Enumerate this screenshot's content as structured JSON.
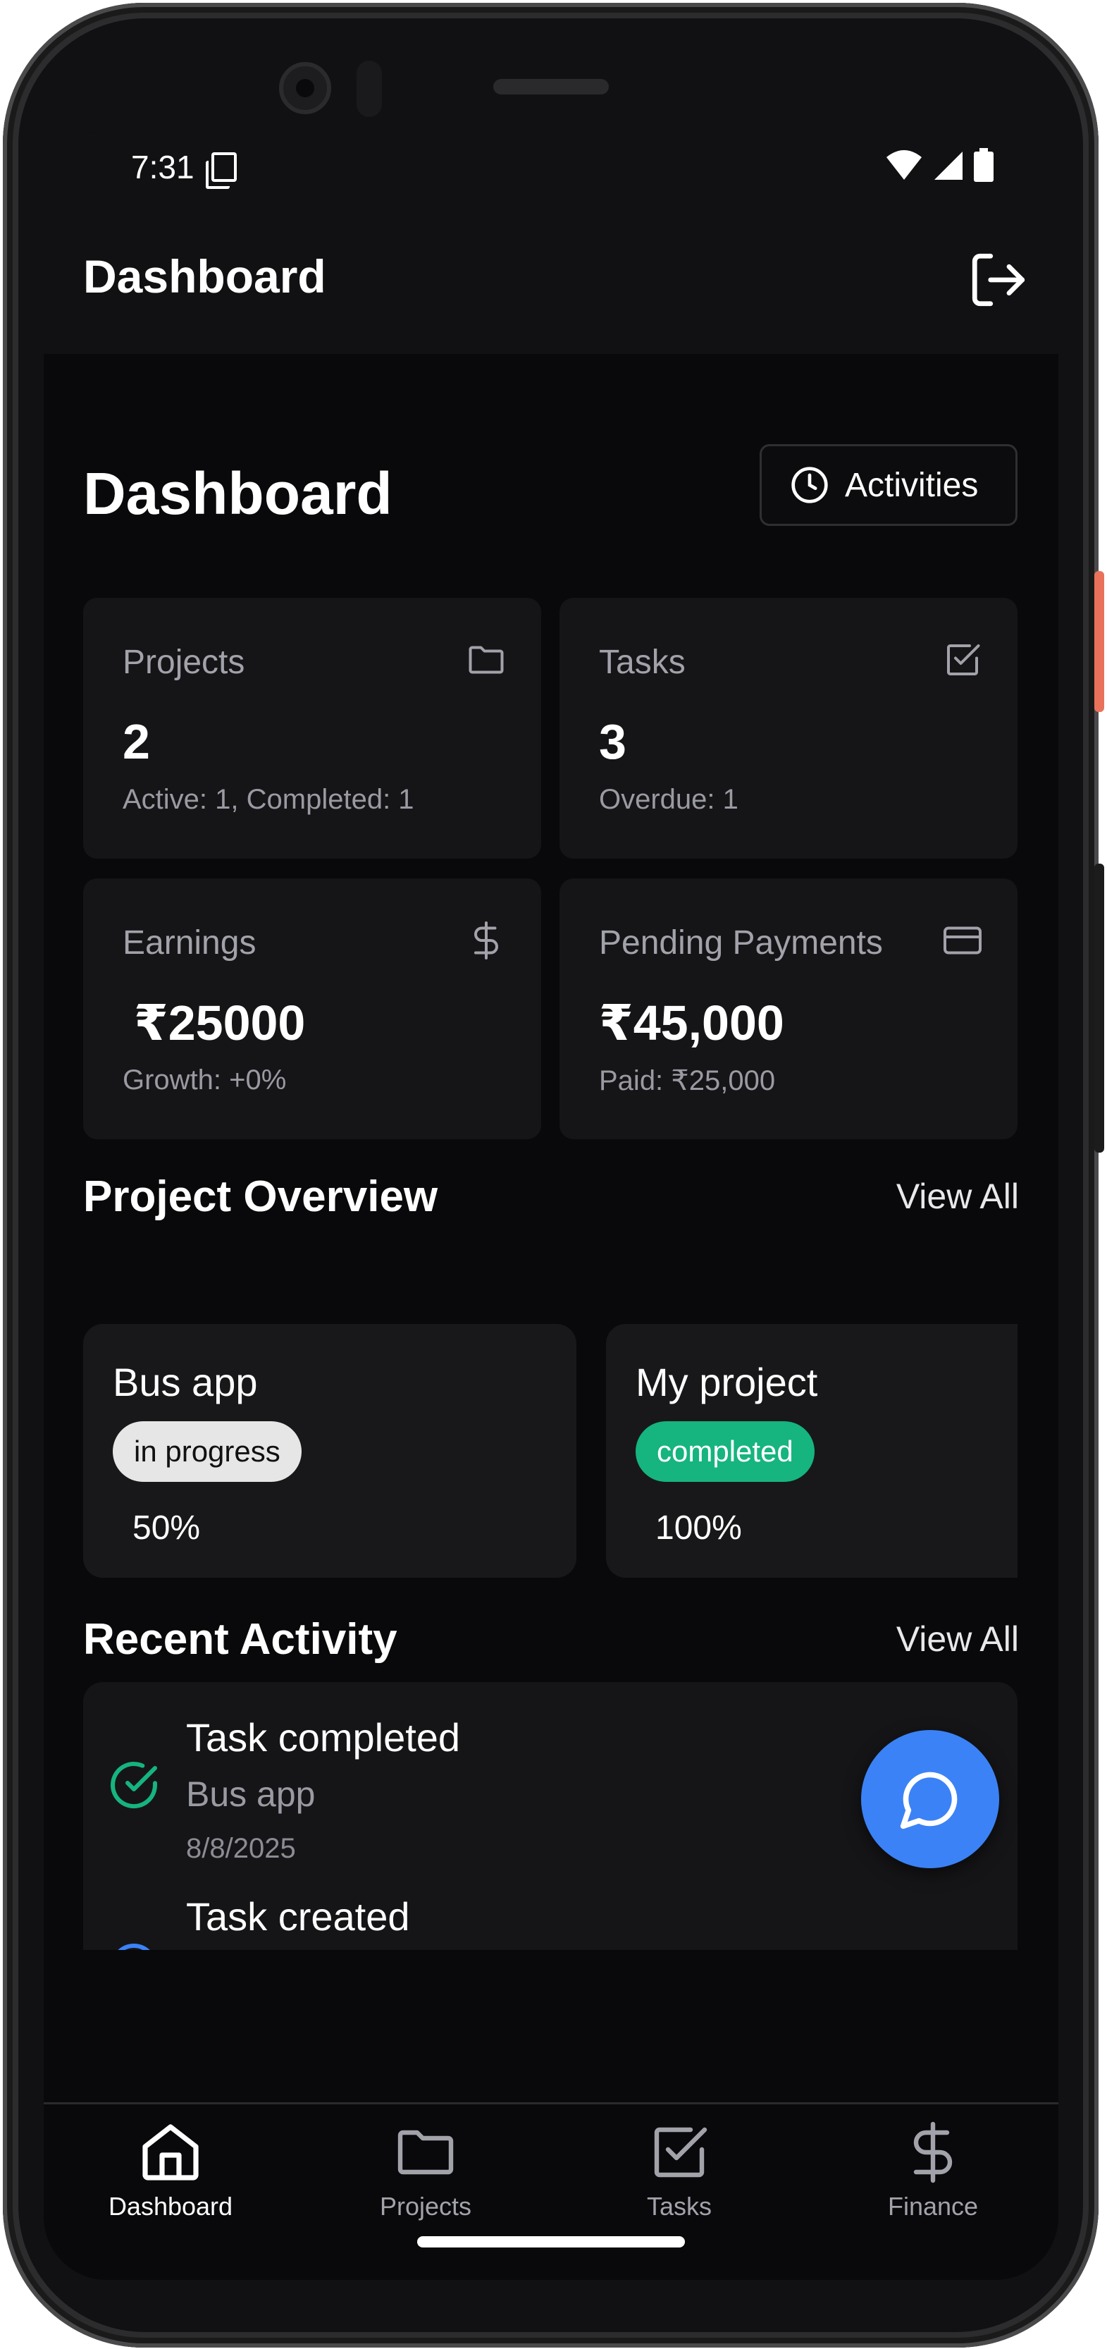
{
  "status_bar": {
    "time": "7:31"
  },
  "app_bar": {
    "title": "Dashboard"
  },
  "page": {
    "title": "Dashboard",
    "activities_label": "Activities"
  },
  "stats": [
    {
      "label": "Projects",
      "value": "2",
      "sub": "Active: 1, Completed: 1",
      "icon": "folder-icon"
    },
    {
      "label": "Tasks",
      "value": "3",
      "sub": "Overdue: 1",
      "icon": "checkbox-icon"
    },
    {
      "label": "Earnings",
      "value": "₹25000",
      "sub": "Growth: +0%",
      "icon": "dollar-icon"
    },
    {
      "label": "Pending Payments",
      "value": "₹45,000",
      "sub": "Paid: ₹25,000",
      "icon": "credit-card-icon"
    }
  ],
  "project_overview": {
    "title": "Project Overview",
    "view_all": "View All",
    "projects": [
      {
        "name": "Bus app",
        "status": "in progress",
        "progress": "50%",
        "badge_bg": "#e6e6e6",
        "badge_fg": "#111111"
      },
      {
        "name": "My project",
        "status": "completed",
        "progress": "100%",
        "badge_bg": "#16b47f",
        "badge_fg": "#ffffff"
      }
    ]
  },
  "recent_activity": {
    "title": "Recent Activity",
    "view_all": "View All",
    "items": [
      {
        "title": "Task completed",
        "project": "Bus app",
        "date": "8/8/2025",
        "icon": "check-circle-icon"
      },
      {
        "title": "Task created",
        "icon": "plus-circle-icon"
      }
    ]
  },
  "bottom_nav": [
    {
      "label": "Dashboard",
      "icon": "home-icon",
      "active": true
    },
    {
      "label": "Projects",
      "icon": "folder-icon",
      "active": false
    },
    {
      "label": "Tasks",
      "icon": "checkbox-icon",
      "active": false
    },
    {
      "label": "Finance",
      "icon": "dollar-icon",
      "active": false
    }
  ],
  "colors": {
    "background": "#09090b",
    "card": "#151517",
    "accent_blue": "#3b82f6",
    "success_green": "#16b47f"
  }
}
